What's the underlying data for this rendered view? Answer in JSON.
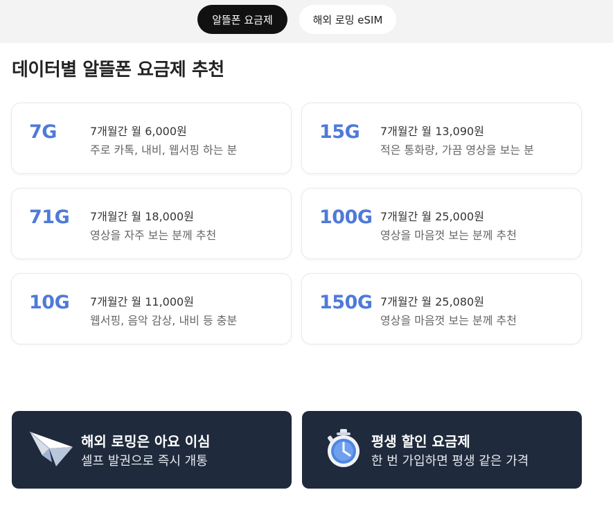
{
  "tabs": {
    "active_label": "알뜰폰 요금제",
    "inactive_label": "해외 로밍 eSIM"
  },
  "heading": "데이터별 알뜰폰 요금제 추천",
  "plans": [
    {
      "data": "7G",
      "price": "7개월간 월 6,000원",
      "desc": "주로 카톡, 내비, 웹서핑 하는 분"
    },
    {
      "data": "15G",
      "price": "7개월간 월 13,090원",
      "desc": "적은 통화량, 가끔 영상을 보는 분"
    },
    {
      "data": "71G",
      "price": "7개월간 월 18,000원",
      "desc": "영상을 자주 보는 분께 추천"
    },
    {
      "data": "100G",
      "price": "7개월간 월 25,000원",
      "desc": "영상을 마음껏 보는 분께 추천"
    },
    {
      "data": "10G",
      "price": "7개월간 월 11,000원",
      "desc": "웹서핑, 음악 감상, 내비 등 충분"
    },
    {
      "data": "150G",
      "price": "7개월간 월 25,080원",
      "desc": "영상을 마음껏 보는 분께 추천"
    }
  ],
  "promos": [
    {
      "title": "해외 로밍은 아요 이심",
      "subtitle": "셀프 발권으로 즉시 개통",
      "icon": "paper-plane-icon"
    },
    {
      "title": "평생 할인 요금제",
      "subtitle": "한 번 가입하면 평생 같은 가격",
      "icon": "stopwatch-icon"
    }
  ],
  "colors": {
    "accent": "#4f7ad8",
    "promo_bg": "#1f2a3c",
    "active_tab": "#111111",
    "topbar_bg": "#f3f3f3"
  }
}
